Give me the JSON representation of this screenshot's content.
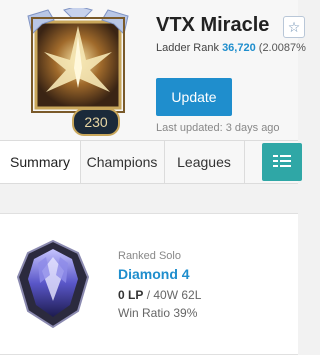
{
  "profile": {
    "summoner_name": "VTX Miracle",
    "level": "230",
    "favorite_icon": "star-outline-icon",
    "ladder_label": "Ladder Rank",
    "ladder_rank": "36,720",
    "ladder_percent": "(2.0087%",
    "update_label": "Update",
    "last_updated": "Last updated: 3 days ago"
  },
  "tabs": [
    {
      "label": "Summary",
      "active": true
    },
    {
      "label": "Champions",
      "active": false
    },
    {
      "label": "Leagues",
      "active": false
    }
  ],
  "tab_action_icon": "list-filter-icon",
  "ranked": {
    "queue": "Ranked Solo",
    "tier": "Diamond 4",
    "lp": "0 LP",
    "record": "/ 40W 62L",
    "win_ratio": "Win Ratio 39%"
  },
  "colors": {
    "accent_blue": "#1f8ecd",
    "teal": "#2fa7a6"
  }
}
